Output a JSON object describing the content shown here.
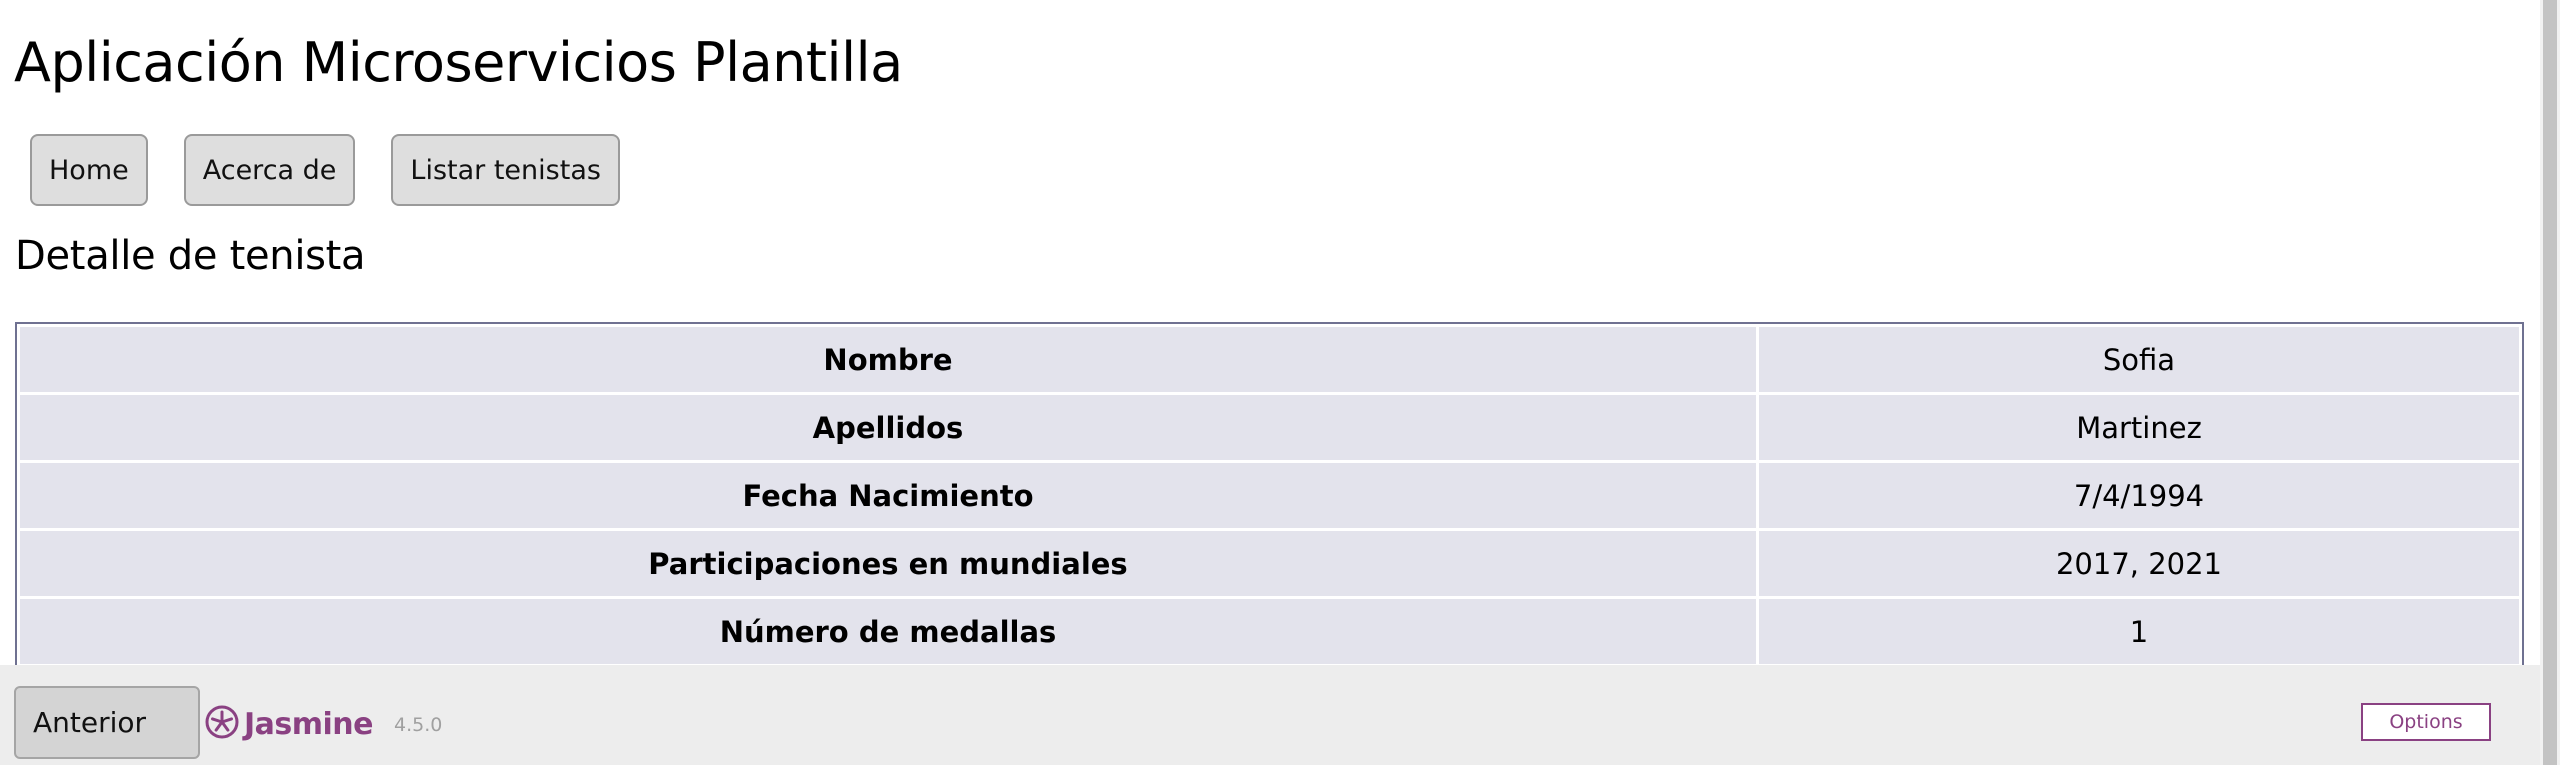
{
  "app_title": "Aplicación Microservicios Plantilla",
  "nav": {
    "home_label": "Home",
    "about_label": "Acerca de",
    "list_label": "Listar tenistas"
  },
  "section_title": "Detalle de tenista",
  "detail": {
    "rows": [
      {
        "label": "Nombre",
        "value": "Sofia"
      },
      {
        "label": "Apellidos",
        "value": "Martinez"
      },
      {
        "label": "Fecha Nacimiento",
        "value": "7/4/1994"
      },
      {
        "label": "Participaciones en mundiales",
        "value": "2017, 2021"
      },
      {
        "label": "Número de medallas",
        "value": "1"
      }
    ]
  },
  "footer": {
    "prev_label": "Anterior",
    "jasmine_name": "Jasmine",
    "jasmine_version": "4.5.0",
    "options_label": "Options"
  },
  "colors": {
    "jasmine_accent": "#8a4182",
    "table_cell_bg": "#e3e3ec",
    "table_border": "#6f7191"
  }
}
